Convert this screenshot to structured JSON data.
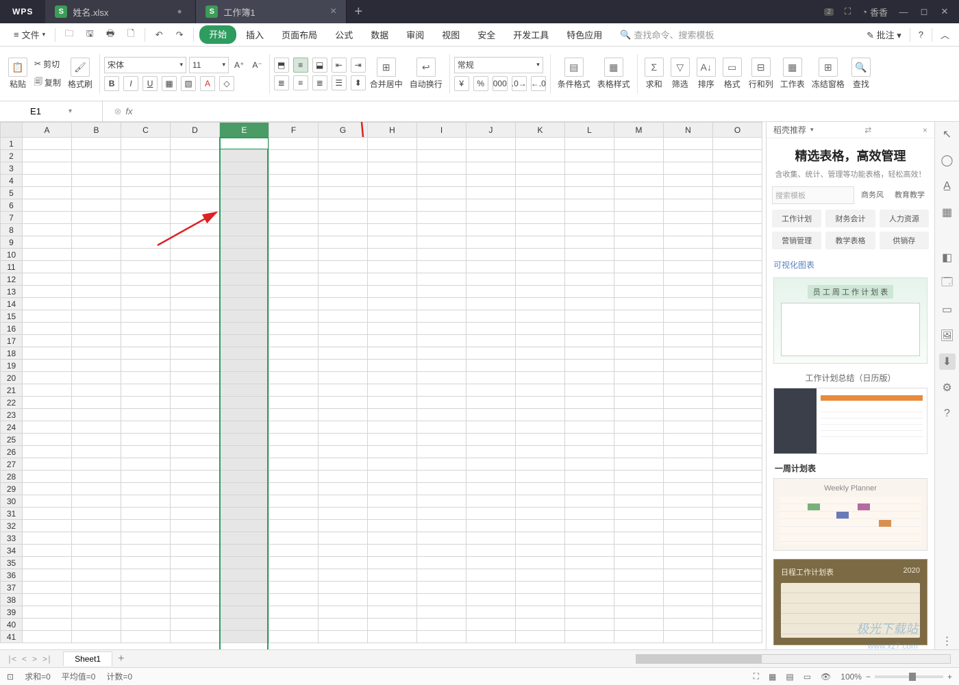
{
  "titlebar": {
    "logo": "WPS",
    "tabs": [
      {
        "icon": "S",
        "label": "姓名.xlsx"
      },
      {
        "icon": "S",
        "label": "工作簿1"
      }
    ],
    "notif_badge": "2",
    "user": "香香"
  },
  "menu": {
    "file": "文件",
    "items": [
      "开始",
      "插入",
      "页面布局",
      "公式",
      "数据",
      "审阅",
      "视图",
      "安全",
      "开发工具",
      "特色应用"
    ],
    "active_index": 0,
    "search_placeholder": "查找命令、搜索模板",
    "comment": "批注"
  },
  "ribbon": {
    "paste": "粘贴",
    "cut": "剪切",
    "copy": "复制",
    "format_painter": "格式刷",
    "font_name": "宋体",
    "font_size": "11",
    "merge_center": "合并居中",
    "wrap": "自动换行",
    "number_format": "常规",
    "cond_format": "条件格式",
    "table_style": "表格样式",
    "sum": "求和",
    "filter": "筛选",
    "sort": "排序",
    "format": "格式",
    "rowscols": "行和列",
    "worksheet": "工作表",
    "freeze": "冻结窗格",
    "find": "查找"
  },
  "namebox": "E1",
  "columns": [
    "A",
    "B",
    "C",
    "D",
    "E",
    "F",
    "G",
    "H",
    "I",
    "J",
    "K",
    "L",
    "M",
    "N",
    "O"
  ],
  "rows": 41,
  "selected_col_index": 4,
  "sidepanel": {
    "head": "稻壳推荐",
    "title": "精选表格，高效管理",
    "subtitle": "含收集、统计、管理等功能表格，轻松高效！",
    "search_placeholder": "搜索模板",
    "search_tabs": [
      "商务风",
      "教育教学"
    ],
    "tags": [
      "工作计划",
      "财务会计",
      "人力资源",
      "营销管理",
      "教学表格",
      "供销存"
    ],
    "section": "可视化图表",
    "template1_label": "员 工 周 工 作 计 划 表",
    "template2_title": "工作计划总结（日历版）",
    "template3_title": "一周计划表",
    "template3_sub": "Weekly Planner",
    "template4_title": "日程工作计划表",
    "template4_year": "2020"
  },
  "sheet": {
    "name": "Sheet1"
  },
  "status": {
    "sum": "求和=0",
    "avg": "平均值=0",
    "count": "计数=0",
    "zoom": "100%"
  },
  "watermark": "极光下载站",
  "watermark_url": "www.xz7.com"
}
